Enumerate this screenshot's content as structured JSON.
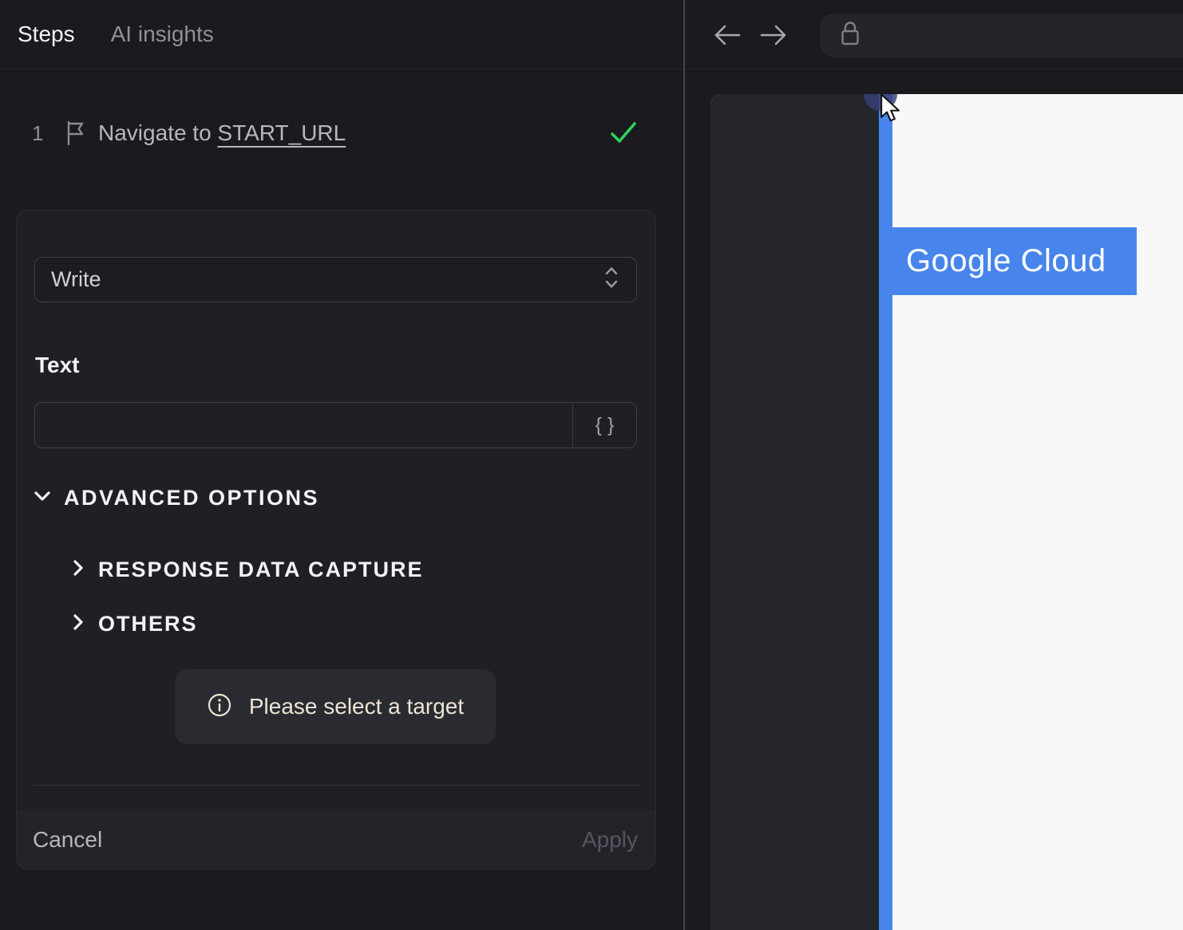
{
  "app": {
    "tabs": [
      {
        "label": "Steps",
        "active": true
      },
      {
        "label": "AI insights",
        "active": false
      }
    ]
  },
  "step": {
    "index": "1",
    "action": "Navigate to ",
    "target": "START_URL",
    "status": "success"
  },
  "editor": {
    "action_type": "Write",
    "text_label": "Text",
    "text_value": "",
    "variable_button": "{ }",
    "advanced_label": "ADVANCED OPTIONS",
    "sections": [
      {
        "label": "RESPONSE DATA CAPTURE"
      },
      {
        "label": "OTHERS"
      }
    ],
    "notice": "Please select a target",
    "cancel_label": "Cancel",
    "apply_label": "Apply"
  },
  "browser": {
    "url_value": "",
    "preview": {
      "highlight_text": "Google Cloud"
    }
  },
  "icons": {
    "step": "flag-icon",
    "status": "check-icon",
    "select": "chevrons-up-down-icon",
    "advanced": "chevron-down-icon",
    "section": "chevron-right-icon",
    "notice": "info-icon",
    "nav": [
      "back-arrow-icon",
      "forward-arrow-icon"
    ],
    "address": "lock-icon",
    "pointer": "cursor-icon"
  },
  "colors": {
    "accent_blue": "#4785ec",
    "success_green": "#2fd15b",
    "notice_text": "#ece5d3",
    "panel_bg": "#1a1a1f",
    "card_bg": "#1f1f25"
  }
}
